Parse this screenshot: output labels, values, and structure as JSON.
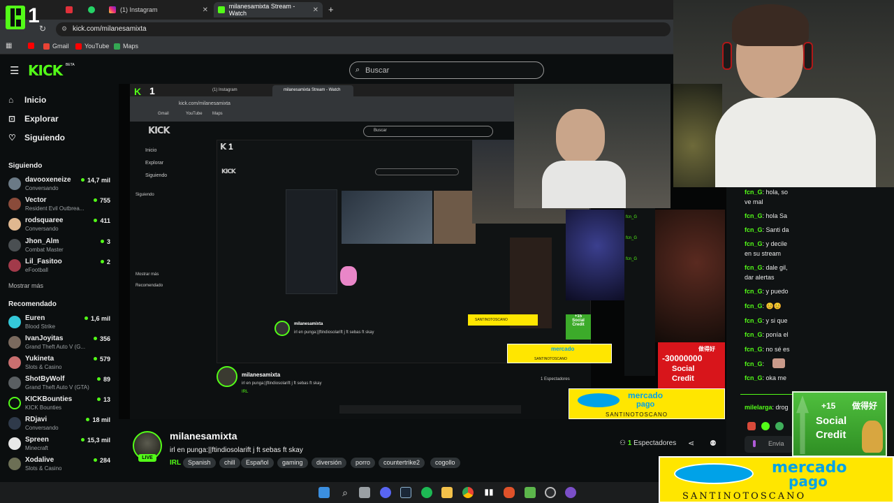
{
  "browser": {
    "tabs": [
      {
        "label": "",
        "icon": "pinned-app-icon"
      },
      {
        "label": "",
        "icon": "whatsapp-icon"
      },
      {
        "label": "(1) Instagram",
        "icon": "instagram-icon"
      },
      {
        "label": "milanesamixta Stream - Watch",
        "icon": "kick-icon"
      }
    ],
    "new_tab": "+",
    "address": "kick.com/milanesamixta",
    "bookmarks": [
      "Gmail",
      "YouTube",
      "Maps"
    ],
    "big_logo": "1"
  },
  "header": {
    "logo": "KICK",
    "logo_beta": "BETA",
    "search_placeholder": "Buscar"
  },
  "sidebar": {
    "nav": [
      {
        "label": "Inicio",
        "icon": "home-icon"
      },
      {
        "label": "Explorar",
        "icon": "compass-icon"
      },
      {
        "label": "Siguiendo",
        "icon": "heart-icon"
      }
    ],
    "following_title": "Siguiendo",
    "following": [
      {
        "name": "davooxeneize",
        "game": "Conversando",
        "viewers": "14,7 mil"
      },
      {
        "name": "Vector",
        "game": "Resident Evil Outbrea...",
        "viewers": "755"
      },
      {
        "name": "rodsquaree",
        "game": "Conversando",
        "viewers": "411"
      },
      {
        "name": "Jhon_Alm",
        "game": "Combat Master",
        "viewers": "3"
      },
      {
        "name": "Lil_Fasitoo",
        "game": "eFootball",
        "viewers": "2"
      }
    ],
    "show_more": "Mostrar más",
    "recommended_title": "Recomendado",
    "recommended": [
      {
        "name": "Euren",
        "game": "Blood Strike",
        "viewers": "1,6 mil"
      },
      {
        "name": "IvanJoyitas",
        "game": "Grand Theft Auto V (G...",
        "viewers": "356"
      },
      {
        "name": "Yukineta",
        "game": "Slots & Casino",
        "viewers": "579"
      },
      {
        "name": "ShotByWolf",
        "game": "Grand Theft Auto V (GTA)",
        "viewers": "89"
      },
      {
        "name": "KICKBounties",
        "game": "KICK Bounties",
        "viewers": "13"
      },
      {
        "name": "RDjavi",
        "game": "Conversando",
        "viewers": "18 mil"
      },
      {
        "name": "Spreen",
        "game": "Minecraft",
        "viewers": "15,3 mil"
      },
      {
        "name": "Xodalive",
        "game": "Slots & Casino",
        "viewers": "284"
      }
    ]
  },
  "stream": {
    "channel": "milanesamixta",
    "title": "irl en punga:||ftindiosolarift j ft sebas ft skay",
    "category": "IRL",
    "tags": [
      "Spanish",
      "chill",
      "Español",
      "gaming",
      "diversión",
      "porro",
      "countertrike2",
      "cogollo"
    ],
    "live_label": "LIVE",
    "viewers_count": "1",
    "viewers_label": "Espectadores"
  },
  "chat": {
    "messages": [
      {
        "user": "fcn_G",
        "text": ": hola, so"
      },
      {
        "user": "",
        "text": "ve mal"
      },
      {
        "user": "fcn_G",
        "text": ": hola Sa"
      },
      {
        "user": "fcn_G",
        "text": ": Santi da"
      },
      {
        "user": "fcn_G",
        "text": ": y decile"
      },
      {
        "user": "",
        "text": "en su stream"
      },
      {
        "user": "fcn_G",
        "text": ": dale gil,"
      },
      {
        "user": "",
        "text": "dar alertas"
      },
      {
        "user": "fcn_G",
        "text": ": y puedo"
      },
      {
        "user": "fcn_G",
        "text": ": 😊😊"
      },
      {
        "user": "fcn_G",
        "text": ": y si que"
      },
      {
        "user": "fcn_G",
        "text": ": ponía el"
      },
      {
        "user": "fcn_G",
        "text": ": no sé es"
      },
      {
        "user": "fcn_G",
        "text": ":"
      },
      {
        "user": "fcn_G",
        "text": ": oka me"
      },
      {
        "user": "milelarga",
        "text": ": drog"
      }
    ],
    "send_label": "Envia"
  },
  "alerts": {
    "credit_amount": "+15",
    "credit_line1": "Social",
    "credit_line2": "Credit",
    "credit_cn": "做得好",
    "mp_line1": "mercado",
    "mp_line2": "pago",
    "mp_sponsor": "SANTINOTOSCANO",
    "neg_credit": "-30000000",
    "neg_line1": "Social",
    "neg_line2": "Credit",
    "neg_cn": "做得好"
  },
  "nested": {
    "search": "Buscar",
    "nav": [
      "Inicio",
      "Explorar",
      "Siguiendo"
    ],
    "following_title": "Siguiendo",
    "recommended_title": "Recomendado",
    "show_more": "Mostrar más",
    "address": "kick.com/milanesamixta",
    "tab_instagram": "(1) Instagram",
    "tab_kick": "milanesamixta Stream - Watch",
    "bookmarks": [
      "Gmail",
      "YouTube",
      "Maps"
    ],
    "viewers": "1 Espectadores",
    "send": "Enviar",
    "mp_sponsor": "SANTINOTOSCANO",
    "chat_user": "milelarga",
    "chat_text": ": drogon"
  },
  "colors": {
    "accent": "#53fc18",
    "background": "#0b0e0f",
    "mercado_pago": "#ffe600",
    "social_credit_green": "#3cab2a",
    "social_credit_red": "#d8151b"
  }
}
